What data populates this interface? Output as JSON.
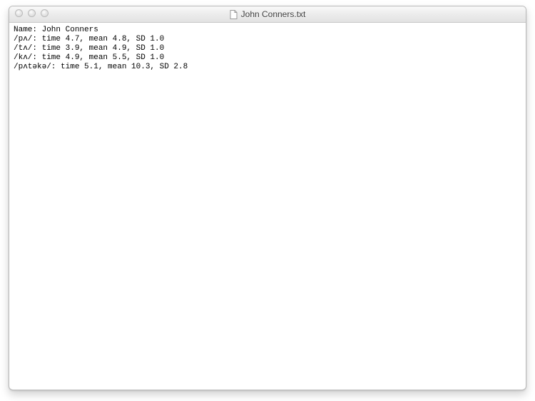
{
  "window": {
    "title": "John Conners.txt"
  },
  "lines": {
    "l0": "Name: John Conners",
    "l1": "/pʌ/: time 4.7, mean 4.8, SD 1.0",
    "l2": "/tʌ/: time 3.9, mean 4.9, SD 1.0",
    "l3": "/kʌ/: time 4.9, mean 5.5, SD 1.0",
    "l4": "/pʌtəkə/: time 5.1, mean 10.3, SD 2.8"
  }
}
